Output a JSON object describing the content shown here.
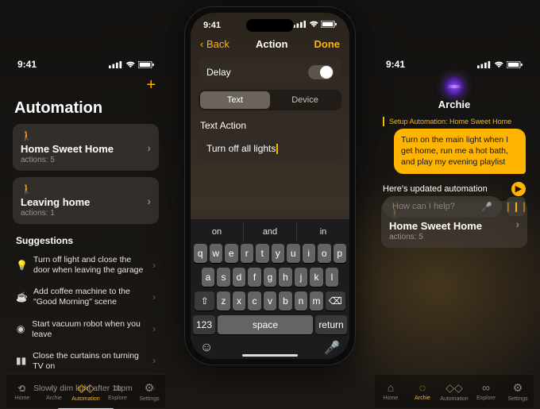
{
  "time": "9:41",
  "left": {
    "heading": "Automation",
    "scenes": [
      {
        "title": "Home Sweet Home",
        "sub": "actions: 5"
      },
      {
        "title": "Leaving home",
        "sub": "actions: 1"
      }
    ],
    "suggestions_heading": "Suggestions",
    "suggestions": [
      "Turn off light and close the door when leaving the garage",
      "Add coffee machine to the \"Good Morning\" scene",
      "Start vacuum robot when you leave",
      "Close the curtains on turning TV on",
      "Slowly dim light after 11pm"
    ],
    "tabs": [
      "Home",
      "Archie",
      "Automation",
      "Explore",
      "Settings"
    ]
  },
  "center": {
    "back": "Back",
    "title": "Action",
    "done": "Done",
    "delay": "Delay",
    "seg": {
      "text": "Text",
      "device": "Device"
    },
    "field_label": "Text Action",
    "field_value": "Turn off all lights",
    "kbd_suggest": [
      "on",
      "and",
      "in"
    ],
    "rows": [
      [
        "q",
        "w",
        "e",
        "r",
        "t",
        "y",
        "u",
        "i",
        "o",
        "p"
      ],
      [
        "a",
        "s",
        "d",
        "f",
        "g",
        "h",
        "j",
        "k",
        "l"
      ],
      [
        "z",
        "x",
        "c",
        "v",
        "b",
        "n",
        "m"
      ]
    ],
    "num": "123",
    "space": "space",
    "return": "return"
  },
  "right": {
    "name": "Archie",
    "quote": "Setup Automation: Home Sweet Home",
    "bubble": "Turn on the main light when I get home, run me a hot bath, and play my evening playlist",
    "reply": "Here's updated automation",
    "card": {
      "title": "Home Sweet Home",
      "sub": "actions: 5"
    },
    "ask": "How can I help?",
    "tabs": [
      "Home",
      "Archie",
      "Automation",
      "Explore",
      "Settings"
    ]
  }
}
